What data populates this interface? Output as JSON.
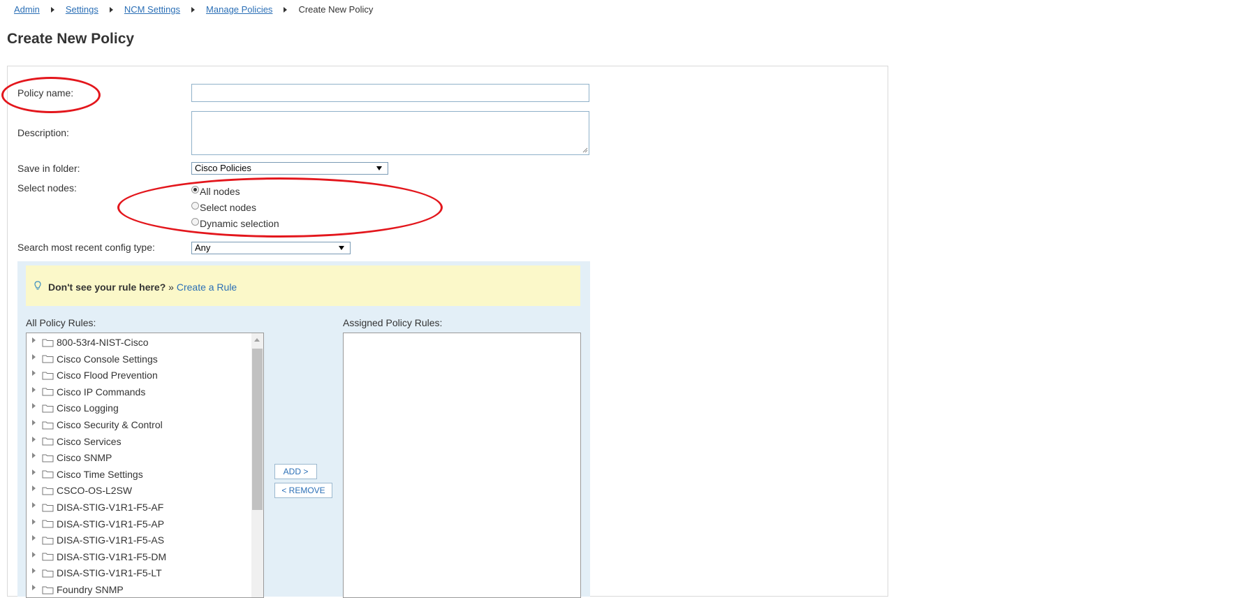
{
  "breadcrumb": {
    "items": [
      "Admin",
      "Settings",
      "NCM Settings",
      "Manage Policies"
    ],
    "current": "Create New Policy"
  },
  "page": {
    "title": "Create New Policy"
  },
  "form": {
    "policy_name_label": "Policy name:",
    "policy_name_value": "",
    "description_label": "Description:",
    "description_value": "",
    "folder_label": "Save in folder:",
    "folder_value": "Cisco Policies",
    "select_nodes_label": "Select nodes:",
    "node_options": [
      "All nodes",
      "Select nodes",
      "Dynamic selection"
    ],
    "node_selected": "All nodes",
    "config_type_label": "Search most recent config type:",
    "config_type_value": "Any"
  },
  "rules": {
    "tip_bold": "Don't see your rule here?",
    "tip_prefix": " » ",
    "tip_link": "Create a Rule",
    "all_label": "All Policy Rules:",
    "assigned_label": "Assigned Policy Rules:",
    "all_items": [
      "800-53r4-NIST-Cisco",
      "Cisco Console Settings",
      "Cisco Flood Prevention",
      "Cisco IP Commands",
      "Cisco Logging",
      "Cisco Security & Control",
      "Cisco Services",
      "Cisco SNMP",
      "Cisco Time Settings",
      "CSCO-OS-L2SW",
      "DISA-STIG-V1R1-F5-AF",
      "DISA-STIG-V1R1-F5-AP",
      "DISA-STIG-V1R1-F5-AS",
      "DISA-STIG-V1R1-F5-DM",
      "DISA-STIG-V1R1-F5-LT",
      "Foundry SNMP"
    ],
    "add_label": "ADD >",
    "remove_label": "< REMOVE"
  },
  "colors": {
    "link": "#2b6fb6",
    "highlight": "#e3161c",
    "tip_bg": "#fbf8c9",
    "panel_bg": "#e3eff7"
  },
  "icons": {
    "breadcrumb_sep": "triangle-right-icon",
    "tip": "lightbulb-icon",
    "tree_node": "folder-icon"
  }
}
